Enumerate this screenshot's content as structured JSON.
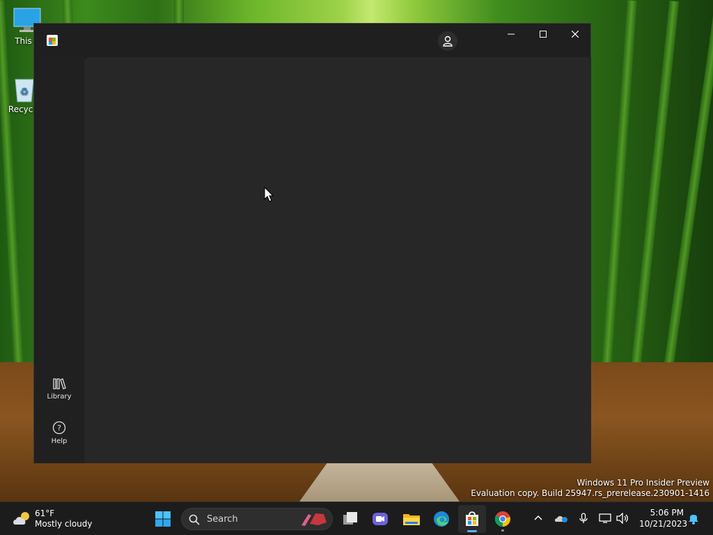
{
  "desktop": {
    "icons": [
      {
        "label": "This P"
      },
      {
        "label": "Recycle"
      }
    ]
  },
  "window": {
    "app_icon": "microsoft-store-icon",
    "account_icon": "account-icon",
    "controls": {
      "minimize": "minimize-icon",
      "maximize": "maximize-icon",
      "close": "close-icon"
    },
    "nav": [
      {
        "label": "Library",
        "icon": "library-icon"
      },
      {
        "label": "Help",
        "icon": "help-icon"
      }
    ]
  },
  "watermark": {
    "line1": "Windows 11 Pro Insider Preview",
    "line2": "Evaluation copy. Build 25947.rs_prerelease.230901-1416"
  },
  "taskbar": {
    "weather": {
      "temp": "61°F",
      "condition": "Mostly cloudy"
    },
    "search_label": "Search",
    "apps": [
      "start-icon",
      "task-view-icon",
      "teams-meet-icon",
      "file-explorer-icon",
      "edge-icon",
      "microsoft-store-icon",
      "chrome-icon"
    ],
    "clock": {
      "time": "5:06 PM",
      "date": "10/21/2023"
    }
  },
  "colors": {
    "window_bg": "#202020",
    "content_bg": "#272727",
    "taskbar_bg": "#1c1c1c",
    "accent": "#5fb2f2"
  }
}
